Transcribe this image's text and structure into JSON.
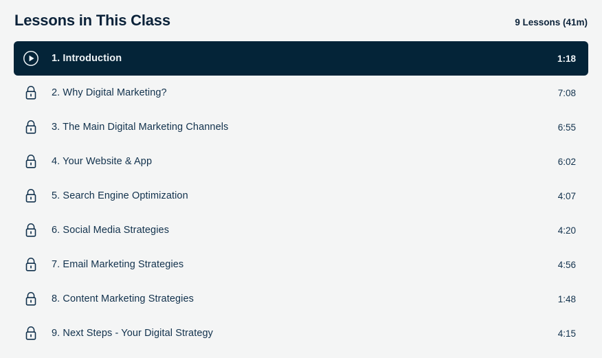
{
  "header": {
    "title": "Lessons in This Class",
    "summary": "9 Lessons (41m)"
  },
  "colors": {
    "page_background": "#f4f5f5",
    "active_row_background": "#042438",
    "text": "#11314c",
    "active_text": "#eef3f6"
  },
  "lessons": [
    {
      "title": "1. Introduction",
      "duration": "1:18",
      "state": "playing",
      "icon": "play-circle-icon",
      "active": true
    },
    {
      "title": "2. Why Digital Marketing?",
      "duration": "7:08",
      "state": "locked",
      "icon": "lock-icon",
      "active": false
    },
    {
      "title": "3. The Main Digital Marketing Channels",
      "duration": "6:55",
      "state": "locked",
      "icon": "lock-icon",
      "active": false
    },
    {
      "title": "4. Your Website & App",
      "duration": "6:02",
      "state": "locked",
      "icon": "lock-icon",
      "active": false
    },
    {
      "title": "5. Search Engine Optimization",
      "duration": "4:07",
      "state": "locked",
      "icon": "lock-icon",
      "active": false
    },
    {
      "title": "6. Social Media Strategies",
      "duration": "4:20",
      "state": "locked",
      "icon": "lock-icon",
      "active": false
    },
    {
      "title": "7. Email Marketing Strategies",
      "duration": "4:56",
      "state": "locked",
      "icon": "lock-icon",
      "active": false
    },
    {
      "title": "8. Content Marketing Strategies",
      "duration": "1:48",
      "state": "locked",
      "icon": "lock-icon",
      "active": false
    },
    {
      "title": "9. Next Steps - Your Digital Strategy",
      "duration": "4:15",
      "state": "locked",
      "icon": "lock-icon",
      "active": false
    }
  ]
}
